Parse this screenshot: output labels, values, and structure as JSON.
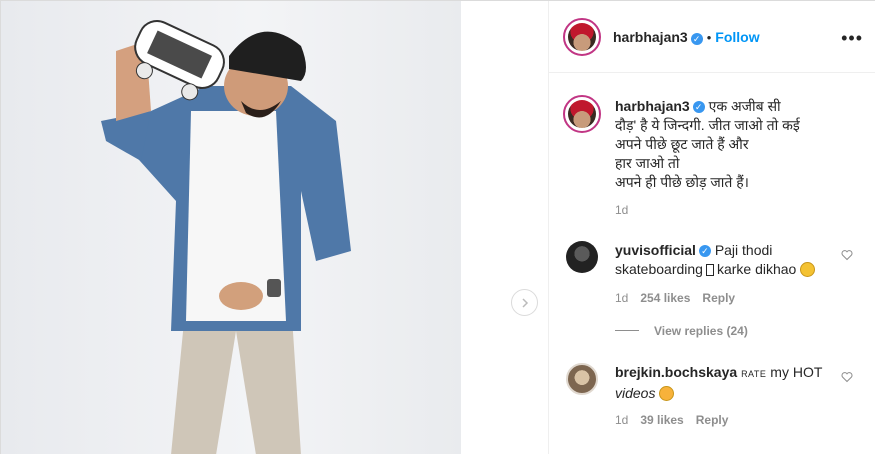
{
  "post": {
    "author": "harbhajan3",
    "follow_label": "Follow",
    "more_label": "•••",
    "next_label": "›"
  },
  "caption": {
    "username": "harbhajan3",
    "lines": [
      "एक अजीब सी",
      "दौड़' है ये जिन्दगी. जीत जाओ तो कई",
      "अपने पीछे छूट जाते हैं और",
      "हार जाओ तो",
      "अपने ही पीछे छोड़ जाते हैं।"
    ],
    "time": "1d"
  },
  "comments": [
    {
      "username": "yuvisofficial",
      "text_part1": "Paji thodi",
      "text_part2a": "skateboarding",
      "text_part2b": "karke dikhao",
      "time": "1d",
      "likes": "254 likes",
      "reply": "Reply",
      "view_replies": "View replies (24)"
    },
    {
      "username": "brejkin.bochskaya",
      "rate": "RATE",
      "text_a": "my HOT",
      "text_b": "videos",
      "time": "1d",
      "likes": "39 likes",
      "reply": "Reply"
    }
  ],
  "colors": {
    "accent": "#0095f6",
    "verified": "#3897f0",
    "muted": "#8e8e8e"
  },
  "icons": [
    "verified-badge-icon",
    "more-options-icon",
    "heart-icon",
    "chevron-right-icon"
  ]
}
